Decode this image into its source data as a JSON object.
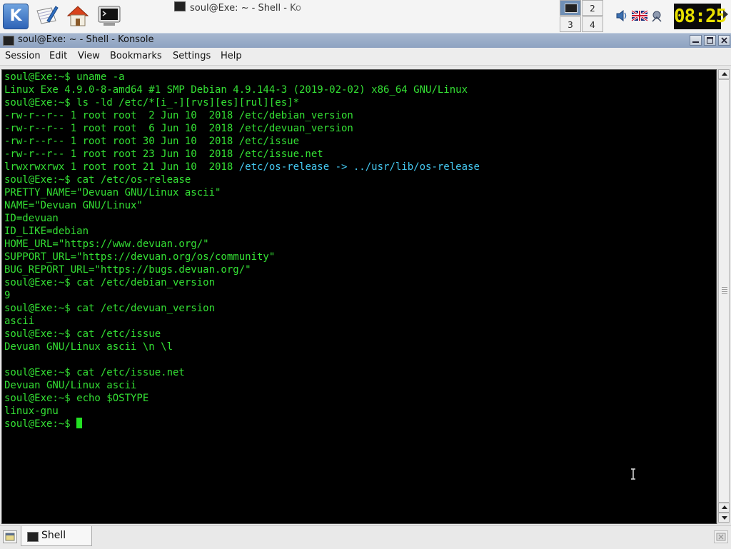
{
  "taskbar": {
    "kmenu_glyph": "K",
    "active_task_title": "soul@Exe: ~ - Shell - Ko",
    "pager": [
      "2",
      "3",
      "4"
    ],
    "clock": "08:25",
    "icons": [
      "kmenu-icon",
      "writer-icon",
      "home-folder-icon",
      "terminal-icon",
      "speaker-icon",
      "keyboard-layout-flag-icon",
      "network-icon"
    ]
  },
  "window": {
    "title": "soul@Exe: ~ - Shell - Konsole",
    "buttons": {
      "minimize": "minimize",
      "maximize": "maximize",
      "close": "close"
    }
  },
  "menubar": {
    "session": "Session",
    "edit": "Edit",
    "view": "View",
    "bookmarks": "Bookmarks",
    "settings": "Settings",
    "help": "Help"
  },
  "terminal": {
    "lines": [
      "soul@Exe:~$ uname -a",
      "Linux Exe 4.9.0-8-amd64 #1 SMP Debian 4.9.144-3 (2019-02-02) x86_64 GNU/Linux",
      "soul@Exe:~$ ls -ld /etc/*[i_-][rvs][es][rul][es]*",
      "-rw-r--r-- 1 root root  2 Jun 10  2018 /etc/debian_version",
      "-rw-r--r-- 1 root root  6 Jun 10  2018 /etc/devuan_version",
      "-rw-r--r-- 1 root root 30 Jun 10  2018 /etc/issue",
      "-rw-r--r-- 1 root root 23 Jun 10  2018 /etc/issue.net",
      "lrwxrwxrwx 1 root root 21 Jun 10  2018 ",
      "soul@Exe:~$ cat /etc/os-release",
      "PRETTY_NAME=\"Devuan GNU/Linux ascii\"",
      "NAME=\"Devuan GNU/Linux\"",
      "ID=devuan",
      "ID_LIKE=debian",
      "HOME_URL=\"https://www.devuan.org/\"",
      "SUPPORT_URL=\"https://devuan.org/os/community\"",
      "BUG_REPORT_URL=\"https://bugs.devuan.org/\"",
      "soul@Exe:~$ cat /etc/debian_version",
      "9",
      "soul@Exe:~$ cat /etc/devuan_version",
      "ascii",
      "soul@Exe:~$ cat /etc/issue",
      "Devuan GNU/Linux ascii \\n \\l",
      "",
      "soul@Exe:~$ cat /etc/issue.net",
      "Devuan GNU/Linux ascii",
      "soul@Exe:~$ echo $OSTYPE",
      "linux-gnu"
    ],
    "symlink_text": "/etc/os-release -> ../usr/lib/os-release",
    "prompt": "soul@Exe:~$ ",
    "colors": {
      "text": "#34e034",
      "link": "#45c8f0",
      "background": "#000000"
    }
  },
  "tabs": [
    {
      "label": "Shell"
    }
  ]
}
